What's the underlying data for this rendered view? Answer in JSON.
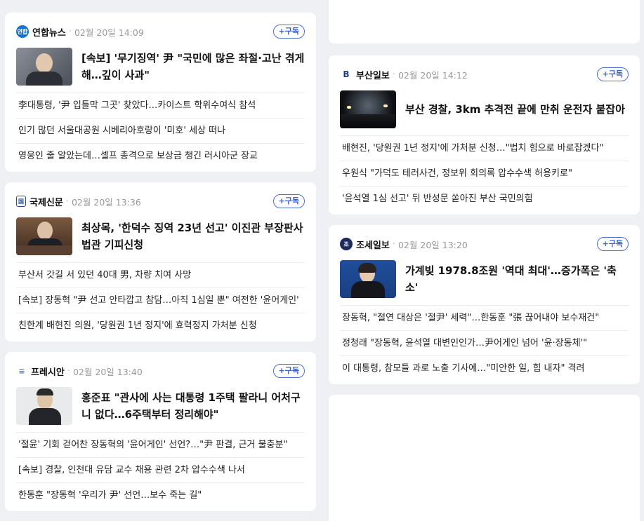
{
  "cards": [
    {
      "press": "연합뉴스",
      "time": "02월 20일 14:09",
      "subscribe": "+구독",
      "logo_color": "#1a73c8",
      "headline": "[속보] '무기징역' 尹 \"국민에 많은 좌절·고난 겪게 해…깊이 사과\"",
      "items": [
        "李대통령, '尹 입틀막 그곳' 찾았다…카이스트 학위수여식 참석",
        "인기 많던 서울대공원 시베리아호랑이 '미호' 세상 떠나",
        "영웅인 줄 알았는데…셀프 총격으로 보상금 챙긴 러시아군 장교"
      ]
    },
    {
      "press": "국제신문",
      "time": "02월 20일 13:36",
      "subscribe": "+구독",
      "logo_color": "#2a4f9e",
      "headline": "최상목, '한덕수 징역 23년 선고' 이진관 부장판사 법관 기피신청",
      "items": [
        "부산서 갓길 서 있던 40대 男, 차량 치여 사망",
        "[속보] 장동혁 \"尹 선고 안타깝고 참담…아직 1심일 뿐\" 여전한 '윤어게인'",
        "친한계 배현진 의원, '당원권 1년 정지'에 효력정지 가처분 신청"
      ]
    },
    {
      "press": "프레시안",
      "time": "02월 20일 13:40",
      "subscribe": "+구독",
      "logo_color": "#6a7fb0",
      "headline": "홍준표 \"관사에 사는 대통령 1주택 팔라니 어처구니 없다…6주택부터 정리해야\"",
      "items": [
        "'절윤' 기회 걷어찬 장동혁의 '윤어게인' 선언?…\"尹 판결, 근거 불충분\"",
        "[속보] 경찰, 인천대 유담 교수 채용 관련 2차 압수수색 나서",
        "한동훈 \"장동혁 '우리가 尹' 선언…보수 죽는 길\""
      ]
    },
    {
      "press": "부산일보",
      "time": "02월 20일 14:12",
      "subscribe": "+구독",
      "logo_color": "#1d3f8a",
      "headline": "부산 경찰, 3km 추격전 끝에 만취 운전자 붙잡아",
      "items": [
        "배현진, '당원권 1년 정지'에 가처분 신청…\"법치 힘으로 바로잡겠다\"",
        "우원식 \"가덕도 테러사건, 정보위 회의록 압수수색 허용키로\"",
        "'윤석열 1심 선고' 뒤 반성문 쏟아진 부산 국민의힘"
      ]
    },
    {
      "press": "조세일보",
      "time": "02월 20일 13:20",
      "subscribe": "+구독",
      "logo_color": "#1c2a5c",
      "headline": "가계빚 1978.8조원 '역대 최대'…증가폭은 '축소'",
      "items": [
        "장동혁, \"절연 대상은 '절尹' 세력\"…한동훈 \"張 끊어내야 보수재건\"",
        "정청래 \"장동혁, 윤석열 대변인인가…尹어게인 넘어 '윤·장동체'\"",
        "이 대통령, 참모들 과로 노출 기사에…\"미안한 일, 힘 내자\" 격려"
      ]
    }
  ]
}
